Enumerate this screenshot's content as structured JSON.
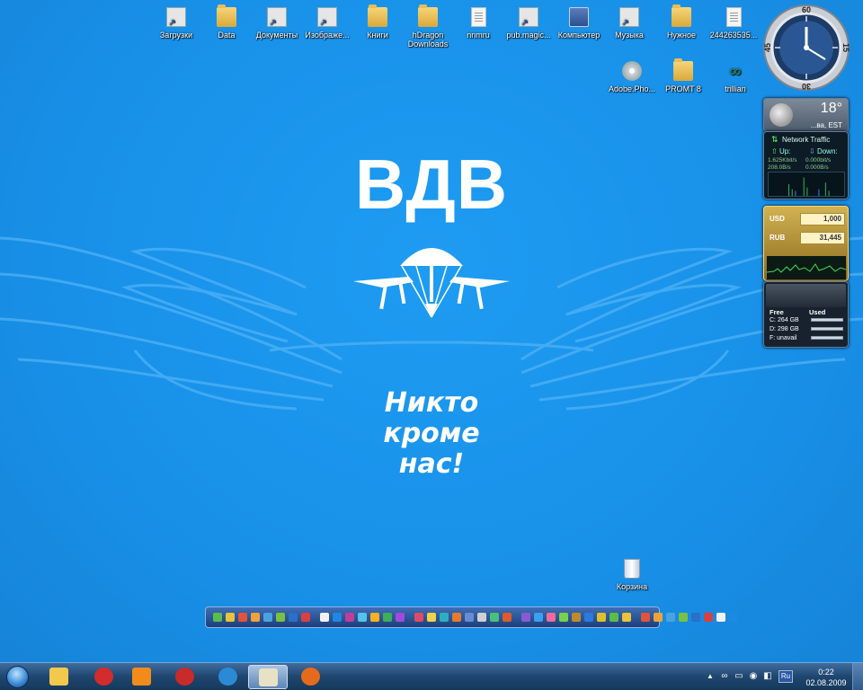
{
  "desktop": {
    "wallpaper": {
      "title": "ВДВ",
      "slogan_line1": "Никто",
      "slogan_line2": "кроме",
      "slogan_line3": "нас!",
      "background_color": "#1a94ea"
    },
    "icons": [
      {
        "label": "Загрузки",
        "icon": "downloads-shortcut-icon"
      },
      {
        "label": "Data",
        "icon": "folder-icon"
      },
      {
        "label": "Документы",
        "icon": "documents-shortcut-icon"
      },
      {
        "label": "Изображе...",
        "icon": "pictures-shortcut-icon"
      },
      {
        "label": "Книги",
        "icon": "folder-icon"
      },
      {
        "label": "hDragon",
        "label2": "Downloads",
        "icon": "folder-icon"
      },
      {
        "label": "nnmru",
        "icon": "document-icon"
      },
      {
        "label": "pub.magic...",
        "icon": "shortcut-icon"
      },
      {
        "label": "Компьютер",
        "icon": "computer-icon"
      },
      {
        "label": "Музыка",
        "icon": "music-shortcut-icon"
      },
      {
        "label": "Нужное",
        "icon": "folder-icon"
      },
      {
        "label": "244263535...",
        "icon": "document-icon"
      },
      {
        "label": "Adobe.Pho...",
        "icon": "disc-image-icon"
      },
      {
        "label": "PROMT 8",
        "icon": "folder-icon"
      },
      {
        "label": "trillian",
        "icon": "trillian-icon"
      },
      {
        "label": "Корзина",
        "icon": "recycle-bin-icon"
      }
    ]
  },
  "gadgets": {
    "clock": {
      "numerals": [
        "60",
        "15",
        "30",
        "45"
      ]
    },
    "weather": {
      "temperature": "18°",
      "location": "...ва, EST"
    },
    "network": {
      "title": "Network Traffic",
      "up_label": "Up:",
      "down_label": "Down:",
      "up_rate": "1.625Kbit/s",
      "down_rate": "0.000bit/s",
      "up_bytes": "208.0B/s",
      "down_bytes": "0.000B/s"
    },
    "currency": {
      "from_code": "USD",
      "from_value": "1,000",
      "to_code": "RUB",
      "to_value": "31,445"
    },
    "drives": {
      "free_label": "Free",
      "used_label": "Used",
      "rows": [
        {
          "text": "C:  264 GB",
          "used_fraction": 0.1
        },
        {
          "text": "D:  298 GB",
          "used_fraction": 0.05
        },
        {
          "text": "F:  unavail",
          "used_fraction": 0
        }
      ]
    }
  },
  "taskbar": {
    "start_label": "Start",
    "buttons": [
      {
        "name": "explorer",
        "icon": "folder-icon",
        "color": "#f2c94c"
      },
      {
        "name": "opera",
        "icon": "opera-icon",
        "color": "#d22c2c"
      },
      {
        "name": "media-player",
        "icon": "media-player-icon",
        "color": "#f28a1c"
      },
      {
        "name": "app-red",
        "icon": "red-circle-icon",
        "color": "#c92a2a"
      },
      {
        "name": "internet-explorer",
        "icon": "internet-explorer-icon",
        "color": "#2a8ad6"
      },
      {
        "name": "notepad",
        "icon": "notepad-icon",
        "color": "#e8e2c4"
      },
      {
        "name": "firefox",
        "icon": "firefox-icon",
        "color": "#e66a1c"
      }
    ],
    "tray": {
      "language": "Ru",
      "time": "0:22",
      "date": "02.08.2009"
    }
  }
}
